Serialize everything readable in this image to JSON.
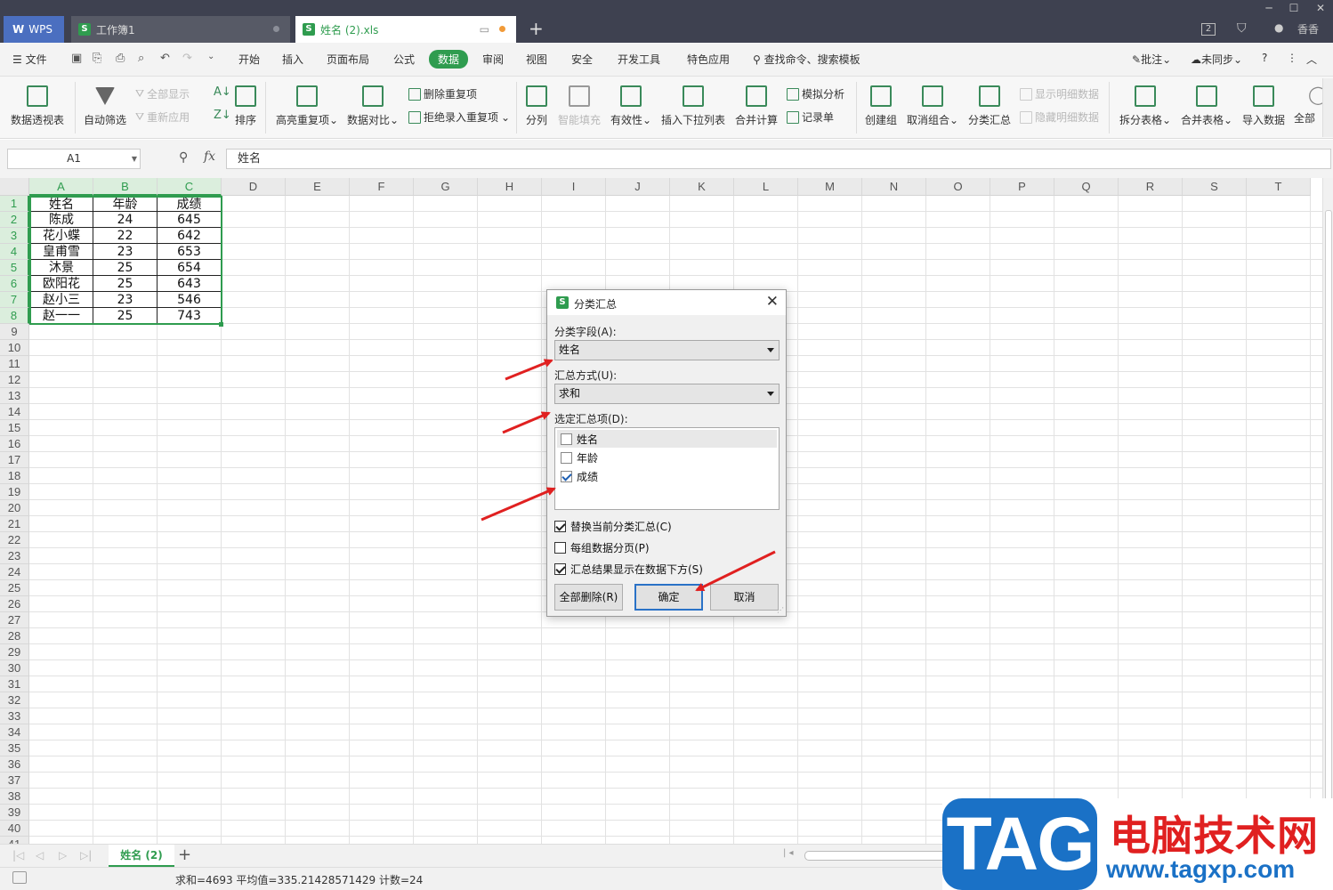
{
  "titlebar": {
    "wps_label": "WPS",
    "tabs": [
      {
        "label": "工作簿1",
        "active": false
      },
      {
        "label": "姓名 (2).xls",
        "active": true
      }
    ],
    "right_badge": "2",
    "user": "香香",
    "colors": {
      "bg": "#3e4150",
      "accent": "#2f9c4f",
      "wps_blue": "#4b6fc0",
      "modified_dot": "#f19a38"
    }
  },
  "menubar": {
    "file_label": "文件",
    "tabs": [
      "开始",
      "插入",
      "页面布局",
      "公式",
      "数据",
      "审阅",
      "视图",
      "安全",
      "开发工具",
      "特色应用"
    ],
    "active_tab": "数据",
    "search_label": "查找命令、搜索模板",
    "annotate_label": "批注",
    "sync_label": "未同步"
  },
  "ribbon": {
    "pivot": "数据透视表",
    "autofilter": "自动筛选",
    "show_all": "全部显示",
    "reapply": "重新应用",
    "sort": "排序",
    "highlight_dup": "高亮重复项",
    "compare": "数据对比",
    "remove_dup": "删除重复项",
    "reject_dup": "拒绝录入重复项",
    "split": "分列",
    "smart_fill": "智能填充",
    "validity": "有效性",
    "dropdown": "插入下拉列表",
    "consolidate": "合并计算",
    "whatif": "模拟分析",
    "form": "记录单",
    "group": "创建组",
    "ungroup": "取消组合",
    "subtotal": "分类汇总",
    "show_detail": "显示明细数据",
    "hide_detail": "隐藏明细数据",
    "split_table": "拆分表格",
    "merge_table": "合并表格",
    "import": "导入数据",
    "all": "全部"
  },
  "formula_bar": {
    "name_box": "A1",
    "fx": "fx",
    "content": "姓名"
  },
  "grid": {
    "columns": [
      "A",
      "B",
      "C",
      "D",
      "E",
      "F",
      "G",
      "H",
      "I",
      "J",
      "K",
      "L",
      "M",
      "N",
      "O",
      "P",
      "Q",
      "R",
      "S",
      "T"
    ],
    "rows": [
      "1",
      "2",
      "3",
      "4",
      "5",
      "6",
      "7",
      "8",
      "9",
      "10",
      "11",
      "12",
      "13",
      "14",
      "15",
      "16",
      "17",
      "18",
      "19",
      "20",
      "21",
      "22",
      "23",
      "24",
      "25",
      "26",
      "27",
      "28",
      "29",
      "30",
      "31",
      "32",
      "33",
      "34",
      "35",
      "36",
      "37",
      "38",
      "39",
      "40",
      "41"
    ],
    "selected_columns": [
      "A",
      "B",
      "C"
    ],
    "selected_rows": 8,
    "data": [
      [
        "姓名",
        "年龄",
        "成绩"
      ],
      [
        "陈成",
        "24",
        "645"
      ],
      [
        "花小蝶",
        "22",
        "642"
      ],
      [
        "皇甫雪",
        "23",
        "653"
      ],
      [
        "沐景",
        "25",
        "654"
      ],
      [
        "欧阳花",
        "25",
        "643"
      ],
      [
        "赵小三",
        "23",
        "546"
      ],
      [
        "赵一一",
        "25",
        "743"
      ]
    ]
  },
  "sheets": {
    "tabs": [
      "姓名 (2)"
    ],
    "active": "姓名 (2)",
    "add": "+"
  },
  "status": {
    "text": "求和=4693   平均值=335.21428571429   计数=24"
  },
  "dialog": {
    "title": "分类汇总",
    "field_label": "分类字段(A):",
    "field_value": "姓名",
    "method_label": "汇总方式(U):",
    "method_value": "求和",
    "items_label": "选定汇总项(D):",
    "items": [
      {
        "label": "姓名",
        "checked": false
      },
      {
        "label": "年龄",
        "checked": false
      },
      {
        "label": "成绩",
        "checked": true
      }
    ],
    "options": [
      {
        "label": "替换当前分类汇总(C)",
        "checked": true
      },
      {
        "label": "每组数据分页(P)",
        "checked": false
      },
      {
        "label": "汇总结果显示在数据下方(S)",
        "checked": true
      }
    ],
    "btn_delete_all": "全部删除(R)",
    "btn_ok": "确定",
    "btn_cancel": "取消",
    "colors": {
      "primary_border": "#2a72c7"
    }
  },
  "annotation_arrows": {
    "count": 4,
    "color": "#e02020"
  },
  "watermark": {
    "logo_text": "TAG",
    "site_name": "电脑技术网",
    "url": "www.tagxp.com",
    "colors": {
      "blue": "#1a71c6",
      "red": "#e02020"
    }
  }
}
